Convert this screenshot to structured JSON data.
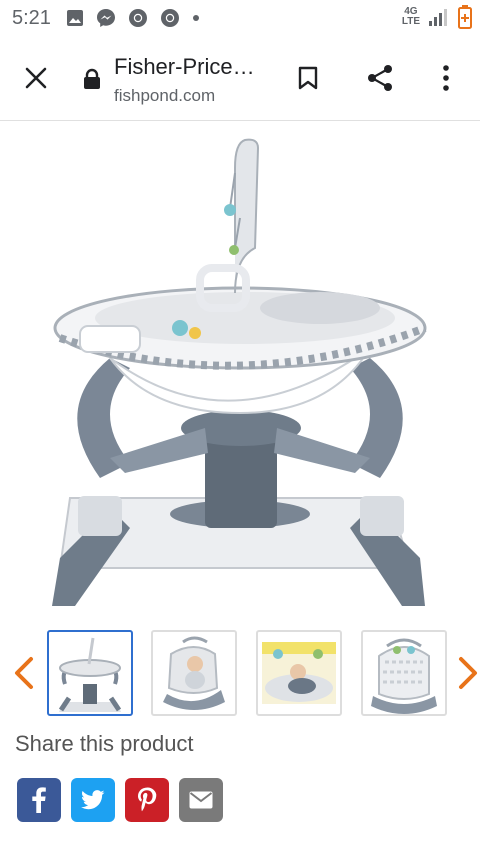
{
  "status": {
    "time": "5:21",
    "network": "4G\nLTE",
    "icons": [
      "image-icon",
      "messenger-icon",
      "chrome-icon",
      "chrome-icon",
      "dot-icon",
      "signal-icon",
      "battery-low-icon"
    ]
  },
  "toolbar": {
    "title": "Fisher-Price…",
    "domain": "fishpond.com",
    "icons": [
      "close-icon",
      "lock-icon",
      "bookmark-icon",
      "share-icon",
      "more-vert-icon"
    ]
  },
  "gallery": {
    "thumbnails": [
      "soothing-glider-thumb",
      "baby-bouncer-thumb",
      "baby-bouncer-yellow-thumb",
      "bouncer-seat-thumb"
    ],
    "active_index": 0,
    "arrow_color": "#e8731a",
    "active_border": "#2f6fcf"
  },
  "share": {
    "heading": "Share this product",
    "buttons": [
      {
        "name": "facebook",
        "icon": "facebook-icon",
        "color": "#3b5998"
      },
      {
        "name": "twitter",
        "icon": "twitter-icon",
        "color": "#1da1f2"
      },
      {
        "name": "pinterest",
        "icon": "pinterest-icon",
        "color": "#cb2027"
      },
      {
        "name": "email",
        "icon": "mail-icon",
        "color": "#7a7a7a"
      }
    ]
  }
}
